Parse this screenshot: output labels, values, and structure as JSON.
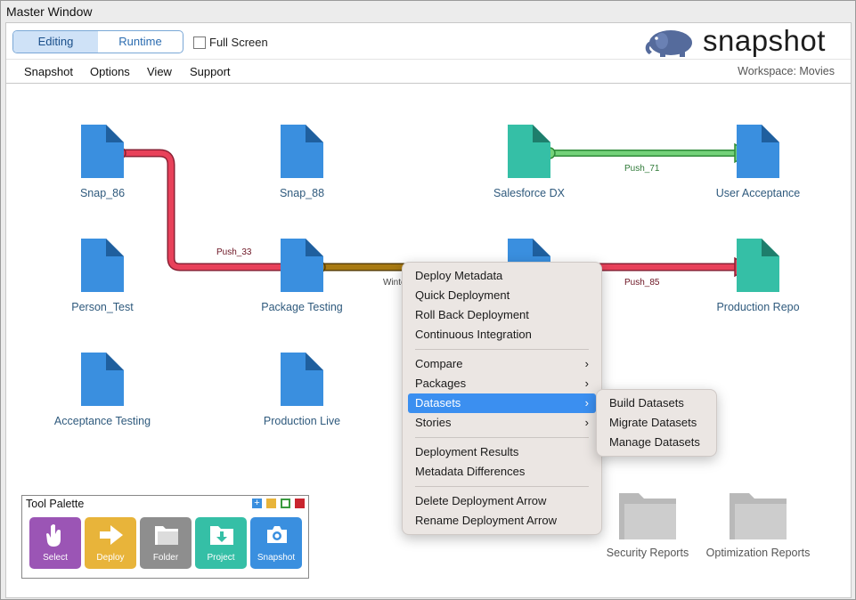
{
  "window": {
    "title": "Master Window"
  },
  "toolbar": {
    "tabs": [
      {
        "label": "Editing",
        "active": true
      },
      {
        "label": "Runtime",
        "active": false
      }
    ],
    "fullscreen_label": "Full Screen",
    "fullscreen_checked": false,
    "logo_text": "snapshot"
  },
  "menubar": {
    "items": [
      "Snapshot",
      "Options",
      "View",
      "Support"
    ],
    "workspace": "Workspace: Movies"
  },
  "nodes": [
    {
      "label": "Snap_86",
      "color": "#3a8fdf"
    },
    {
      "label": "Snap_88",
      "color": "#3a8fdf"
    },
    {
      "label": "Salesforce DX",
      "color": "#35bfa6"
    },
    {
      "label": "User Acceptance",
      "color": "#3a8fdf"
    },
    {
      "label": "Person_Test",
      "color": "#3a8fdf"
    },
    {
      "label": "Package Testing",
      "color": "#3a8fdf"
    },
    {
      "label": "",
      "color": "#3a8fdf"
    },
    {
      "label": "Production Repo",
      "color": "#35bfa6"
    },
    {
      "label": "Acceptance Testing",
      "color": "#3a8fdf"
    },
    {
      "label": "Production Live",
      "color": "#3a8fdf"
    }
  ],
  "edges": [
    {
      "label": "Push_33",
      "color": "#e8415a"
    },
    {
      "label": "Push_71",
      "color": "#58c85f"
    },
    {
      "label": "Push_85",
      "color": "#e8415a"
    },
    {
      "label": "Winte",
      "color": "#a87a12"
    }
  ],
  "context_menu": {
    "groups": [
      [
        {
          "label": "Deploy Metadata"
        },
        {
          "label": "Quick Deployment"
        },
        {
          "label": "Roll Back Deployment"
        },
        {
          "label": "Continuous Integration"
        }
      ],
      [
        {
          "label": "Compare",
          "submenu": true
        },
        {
          "label": "Packages",
          "submenu": true
        },
        {
          "label": "Datasets",
          "submenu": true,
          "selected": true
        },
        {
          "label": "Stories",
          "submenu": true
        }
      ],
      [
        {
          "label": "Deployment Results"
        },
        {
          "label": "Metadata Differences"
        }
      ],
      [
        {
          "label": "Delete Deployment Arrow"
        },
        {
          "label": "Rename Deployment Arrow"
        }
      ]
    ],
    "submenu": [
      "Build Datasets",
      "Migrate Datasets",
      "Manage Datasets"
    ]
  },
  "palette": {
    "title": "Tool Palette",
    "buttons": [
      {
        "label": "Select",
        "color": "#9b55b5",
        "icon": "hand-icon"
      },
      {
        "label": "Deploy",
        "color": "#e8b43a",
        "icon": "arrow-right-icon"
      },
      {
        "label": "Folder",
        "color": "#8e8e8e",
        "icon": "folder-icon"
      },
      {
        "label": "Project",
        "color": "#35bfa6",
        "icon": "download-icon"
      },
      {
        "label": "Snapshot",
        "color": "#3a8fdf",
        "icon": "camera-icon"
      }
    ]
  },
  "folders": [
    {
      "label": "Security Reports"
    },
    {
      "label": "Optimization Reports"
    }
  ],
  "colors": {
    "accent": "#3b8ff0",
    "node_blue": "#3a8fdf",
    "node_teal": "#35bfa6"
  }
}
